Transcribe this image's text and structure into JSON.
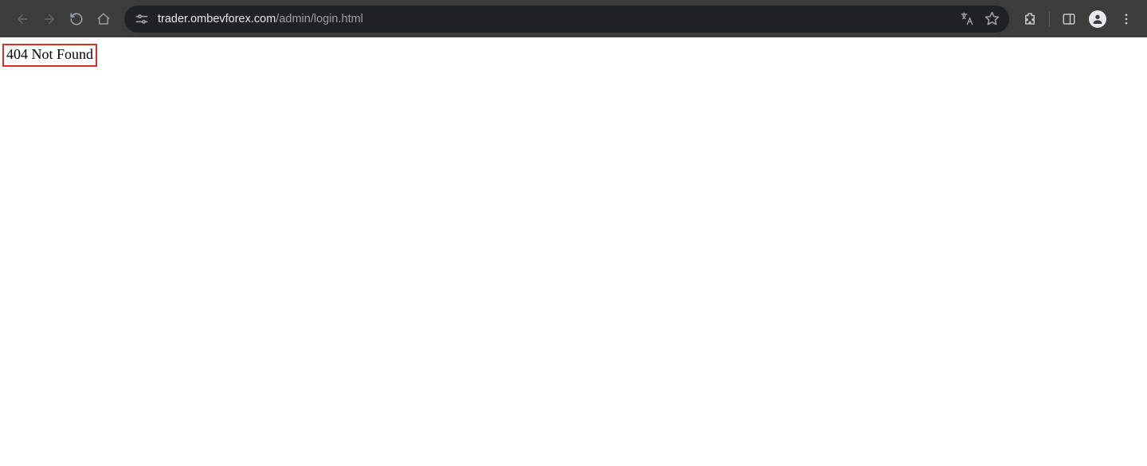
{
  "toolbar": {
    "url_host": "trader.ombevforex.com",
    "url_path": "/admin/login.html"
  },
  "page": {
    "error_text": "404 Not Found"
  }
}
